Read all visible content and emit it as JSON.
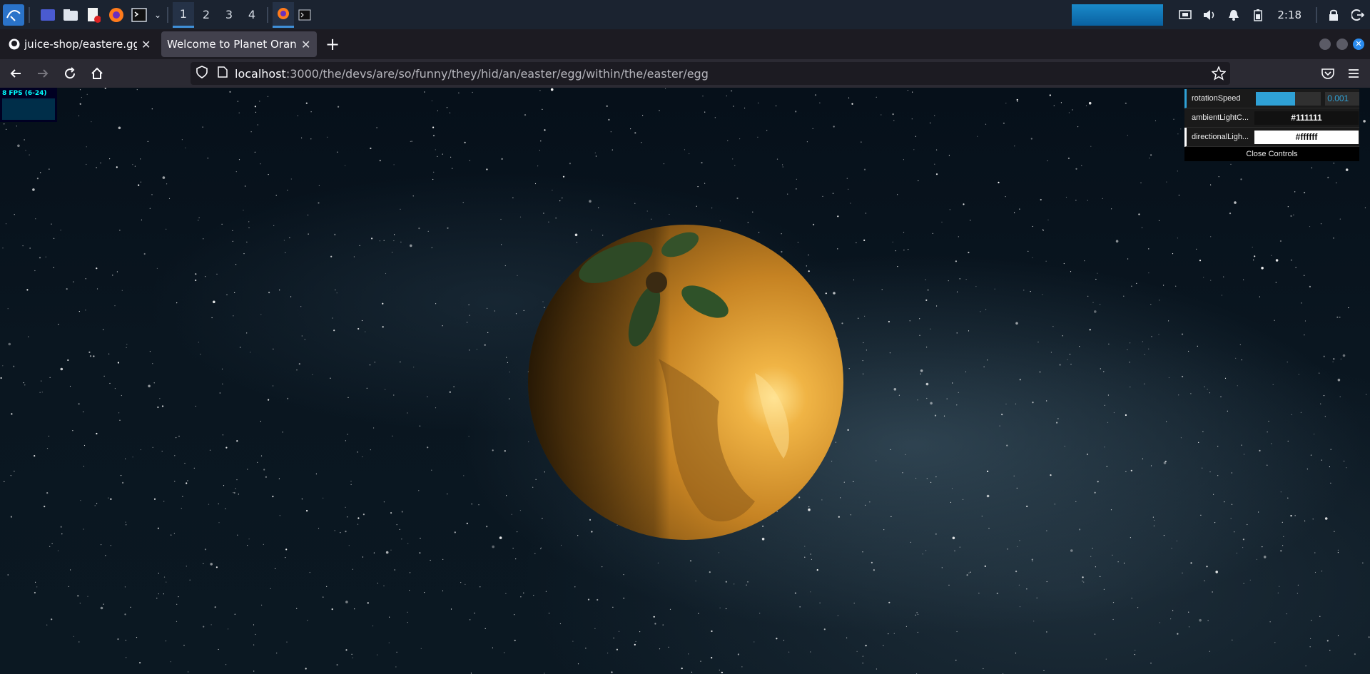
{
  "os_panel": {
    "workspaces": [
      "1",
      "2",
      "3",
      "4"
    ],
    "active_workspace": "1",
    "clock": "2:18",
    "icons": [
      "kali-menu-icon",
      "show-desktop-icon",
      "file-manager-icon",
      "text-editor-icon",
      "firefox-icon",
      "terminal-icon",
      "chevron-down-icon"
    ],
    "tray_icons": [
      "screen-icon",
      "volume-icon",
      "notification-bell-icon",
      "battery-icon",
      "lock-icon",
      "logout-icon"
    ]
  },
  "browser": {
    "tabs": [
      {
        "title": "juice-shop/eastere.gg at",
        "icon": "github-icon",
        "active": false
      },
      {
        "title": "Welcome to Planet Orangeuz",
        "icon": "",
        "active": true
      }
    ],
    "url_host": "localhost",
    "url_path": ":3000/the/devs/are/so/funny/they/hid/an/easter/egg/within/the/easter/egg"
  },
  "page": {
    "stats": {
      "text": "8 FPS (6-24)"
    },
    "gui": {
      "rotation_label": "rotationSpeed",
      "rotation_value": "0.001",
      "rotation_fill": 0.6,
      "ambient_label": "ambientLightC...",
      "ambient_value": "#111111",
      "directional_label": "directionalLigh...",
      "directional_value": "#ffffff",
      "close_label": "Close Controls"
    }
  },
  "colors": {
    "accent": "#2fa1d6",
    "planet": "#c8861f",
    "leaf": "#2e4a26"
  }
}
